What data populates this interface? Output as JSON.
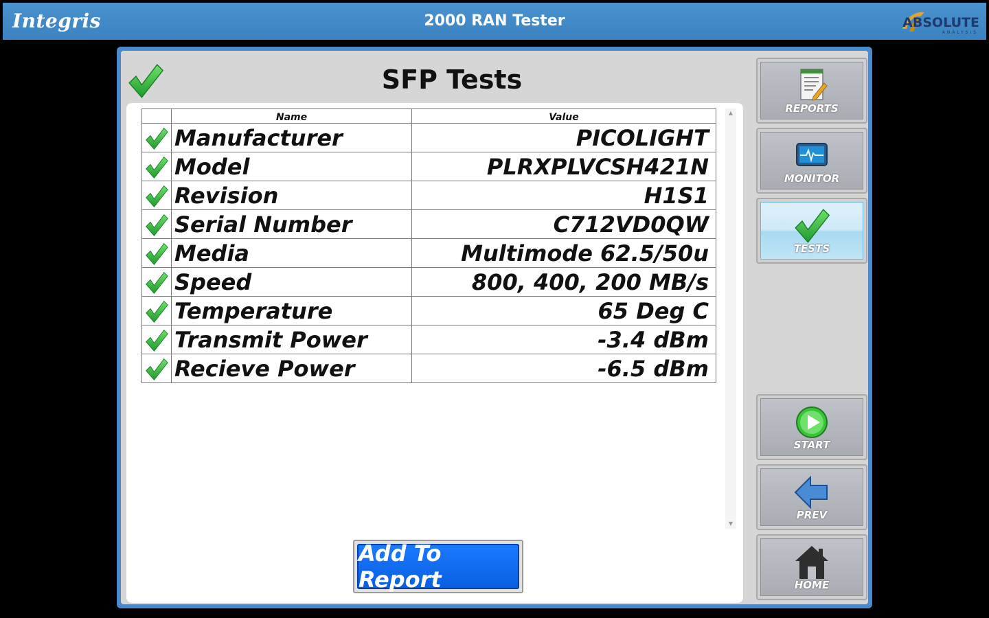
{
  "app": {
    "window_title": "2000 RAN Tester",
    "brand_left": "Integris",
    "brand_right": "ABSOLUTE",
    "brand_right_sub": "ANALYSIS"
  },
  "page": {
    "title": "SFP Tests",
    "status_icon": "check-icon"
  },
  "table": {
    "headers": {
      "name": "Name",
      "value": "Value"
    },
    "rows": [
      {
        "name": "Manufacturer",
        "value": "PICOLIGHT",
        "status": "pass"
      },
      {
        "name": "Model",
        "value": "PLRXPLVCSH421N",
        "status": "pass"
      },
      {
        "name": "Revision",
        "value": "H1S1",
        "status": "pass"
      },
      {
        "name": "Serial Number",
        "value": "C712VD0QW",
        "status": "pass"
      },
      {
        "name": "Media",
        "value": "Multimode 62.5/50u",
        "status": "pass"
      },
      {
        "name": "Speed",
        "value": "800, 400, 200 MB/s",
        "status": "pass"
      },
      {
        "name": "Temperature",
        "value": "65 Deg C",
        "status": "pass"
      },
      {
        "name": "Transmit Power",
        "value": "-3.4 dBm",
        "status": "pass"
      },
      {
        "name": "Recieve Power",
        "value": "-6.5 dBm",
        "status": "pass"
      }
    ]
  },
  "actions": {
    "add_to_report": "Add To Report"
  },
  "sidebar": {
    "items": [
      {
        "label": "REPORTS",
        "icon": "report-icon",
        "active": false
      },
      {
        "label": "MONITOR",
        "icon": "monitor-icon",
        "active": false
      },
      {
        "label": "TESTS",
        "icon": "check-icon",
        "active": true
      },
      {
        "label": "START",
        "icon": "play-icon",
        "active": false
      },
      {
        "label": "PREV",
        "icon": "arrow-left-icon",
        "active": false
      },
      {
        "label": "HOME",
        "icon": "home-icon",
        "active": false
      }
    ]
  },
  "colors": {
    "titlebar": "#3b82c0",
    "frame": "#4a8bcb",
    "check_green": "#2fae3f",
    "report_button": "#1a7aff"
  }
}
